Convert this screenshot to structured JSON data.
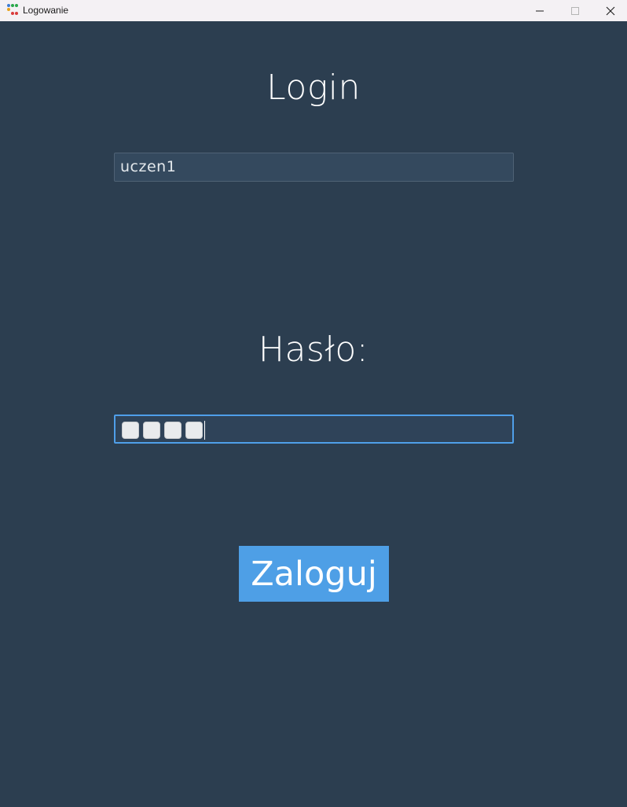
{
  "window": {
    "title": "Logowanie",
    "controls": {
      "minimize": "minimize-icon",
      "maximize": "maximize-icon",
      "close": "close-icon"
    }
  },
  "form": {
    "login_heading": "Login",
    "login_value": "uczen1",
    "password_heading": "Hasło:",
    "password_mask_count": 4,
    "submit_label": "Zaloguj"
  },
  "colors": {
    "background": "#2c3e50",
    "input_background": "#34495e",
    "focus_border": "#4f9fe9",
    "button_background": "#4e9fe6",
    "text": "#ffffff"
  }
}
